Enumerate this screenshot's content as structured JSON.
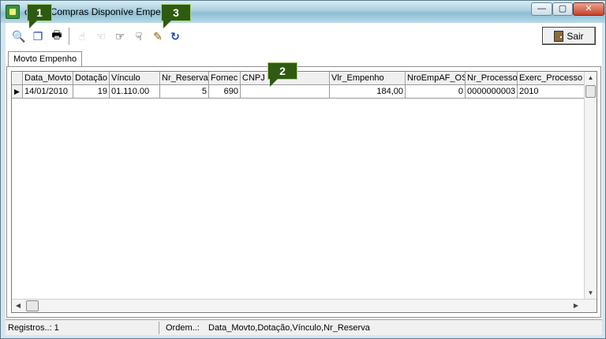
{
  "window": {
    "title": "os de Compras Disponíve    Empenho",
    "min_glyph": "—",
    "max_glyph": "▢",
    "close_glyph": "✕"
  },
  "toolbar": {
    "buttons": [
      {
        "name": "search",
        "glyph": "🔍",
        "enabled": true
      },
      {
        "name": "copy",
        "glyph": "❐",
        "enabled": true
      },
      {
        "name": "print",
        "glyph": "🖶",
        "enabled": true
      },
      {
        "name": "hand-up",
        "glyph": "☝",
        "enabled": false
      },
      {
        "name": "hand-left",
        "glyph": "☜",
        "enabled": false
      },
      {
        "name": "hand-right",
        "glyph": "☞",
        "enabled": true
      },
      {
        "name": "hand-down",
        "glyph": "☟",
        "enabled": true
      },
      {
        "name": "edit",
        "glyph": "✎",
        "enabled": true
      },
      {
        "name": "refresh",
        "glyph": "↻",
        "enabled": true
      }
    ],
    "sair_label": "Sair"
  },
  "tabs": [
    {
      "label": "Movto Empenho"
    }
  ],
  "grid": {
    "columns": [
      {
        "label": "Data_Movto",
        "width": 64,
        "align": "left"
      },
      {
        "label": "Dotação",
        "width": 46,
        "align": "right"
      },
      {
        "label": "Vínculo",
        "width": 64,
        "align": "left"
      },
      {
        "label": "Nr_Reserva",
        "width": 62,
        "align": "right"
      },
      {
        "label": "Fornec",
        "width": 40,
        "align": "right"
      },
      {
        "label": "CNPJ",
        "width": 113,
        "align": "left"
      },
      {
        "label": "Vlr_Empenho",
        "width": 96,
        "align": "right"
      },
      {
        "label": "NroEmpAF_OS",
        "width": 76,
        "align": "right"
      },
      {
        "label": "Nr_Processo",
        "width": 66,
        "align": "left"
      },
      {
        "label": "Exerc_Processo",
        "width": 85,
        "align": "left"
      }
    ],
    "rows": [
      [
        "14/01/2010",
        "19",
        "01.110.00",
        "5",
        "690",
        "",
        "184,00",
        "0",
        "0000000003",
        "2010"
      ]
    ],
    "row_indicator": "▶"
  },
  "status": {
    "registros": "Registros..: 1",
    "ordem_label": "Ordem..:",
    "ordem_value": "Data_Movto,Dotação,Vínculo,Nr_Reserva"
  },
  "callouts": [
    "1",
    "2",
    "3"
  ]
}
